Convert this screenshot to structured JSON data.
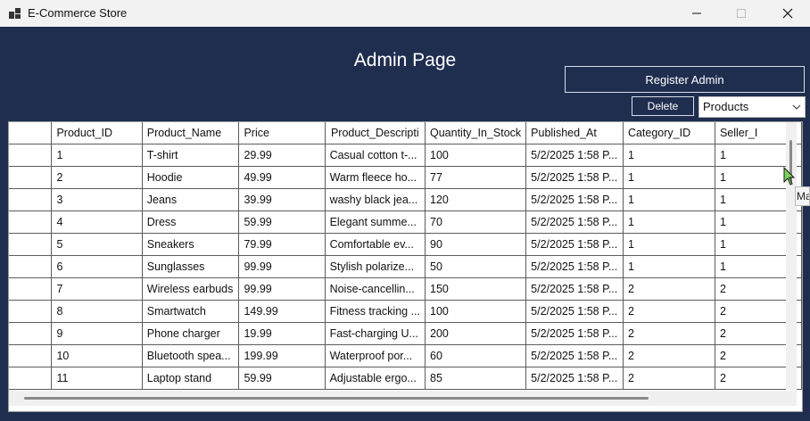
{
  "window": {
    "title": "E-Commerce Store"
  },
  "page": {
    "title": "Admin Page",
    "register_label": "Register Admin",
    "delete_label": "Delete",
    "table_select": "Products"
  },
  "grid": {
    "columns": [
      "Product_ID",
      "Product_Name",
      "Price",
      "Product_Descripti",
      "Quantity_In_Stock",
      "Published_At",
      "Category_ID",
      "Seller_I"
    ],
    "rows": [
      [
        "1",
        "T-shirt",
        "29.99",
        "Casual cotton t-...",
        "100",
        "5/2/2025 1:58 P...",
        "1",
        "1"
      ],
      [
        "2",
        "Hoodie",
        "49.99",
        "Warm fleece ho...",
        "77",
        "5/2/2025 1:58 P...",
        "1",
        "1"
      ],
      [
        "3",
        "Jeans",
        "39.99",
        "washy black jea...",
        "120",
        "5/2/2025 1:58 P...",
        "1",
        "1"
      ],
      [
        "4",
        "Dress",
        "59.99",
        "Elegant summe...",
        "70",
        "5/2/2025 1:58 P...",
        "1",
        "1"
      ],
      [
        "5",
        "Sneakers",
        "79.99",
        "Comfortable ev...",
        "90",
        "5/2/2025 1:58 P...",
        "1",
        "1"
      ],
      [
        "6",
        "Sunglasses",
        "99.99",
        "Stylish polarize...",
        "50",
        "5/2/2025 1:58 P...",
        "1",
        "1"
      ],
      [
        "7",
        "Wireless earbuds",
        "99.99",
        "Noise-cancellin...",
        "150",
        "5/2/2025 1:58 P...",
        "2",
        "2"
      ],
      [
        "8",
        "Smartwatch",
        "149.99",
        "Fitness tracking ...",
        "100",
        "5/2/2025 1:58 P...",
        "2",
        "2"
      ],
      [
        "9",
        "Phone charger",
        "19.99",
        "Fast-charging U...",
        "200",
        "5/2/2025 1:58 P...",
        "2",
        "2"
      ],
      [
        "10",
        "Bluetooth spea...",
        "199.99",
        "Waterproof por...",
        "60",
        "5/2/2025 1:58 P...",
        "2",
        "2"
      ],
      [
        "11",
        "Laptop stand",
        "59.99",
        "Adjustable ergo...",
        "85",
        "5/2/2025 1:58 P...",
        "2",
        "2"
      ]
    ]
  },
  "tooltip_fragment": "Ma",
  "colors": {
    "background": "#1f2e4f",
    "titlebar": "#f2f2f2",
    "grid_line": "#5c5c5c"
  },
  "icons": {
    "app": "app-window-icon",
    "minimize": "minimize-icon",
    "maximize": "maximize-icon",
    "close": "close-icon",
    "dropdown": "chevron-down-icon"
  }
}
